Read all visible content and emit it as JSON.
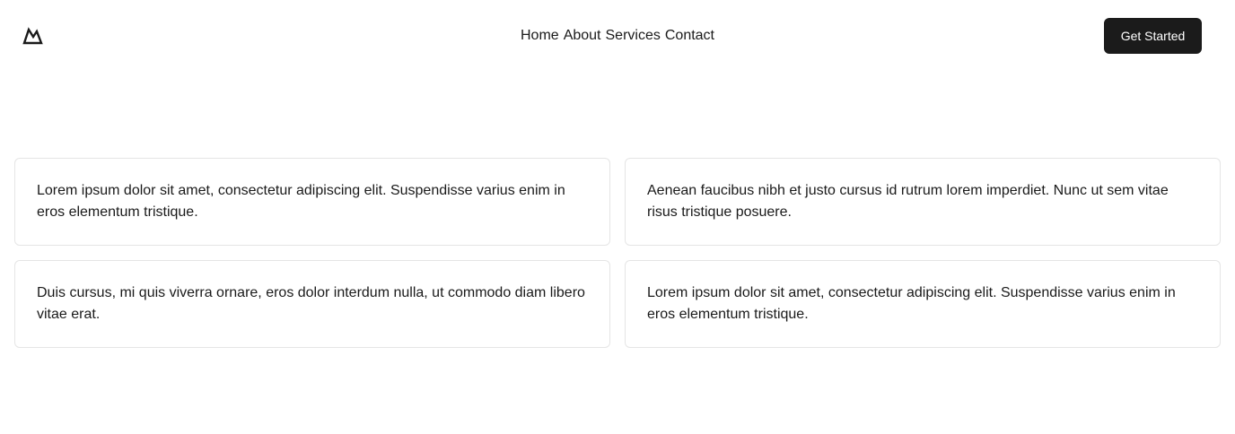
{
  "header": {
    "logo_icon": "mountain-icon",
    "nav": [
      {
        "label": "Home"
      },
      {
        "label": "About"
      },
      {
        "label": "Services"
      },
      {
        "label": "Contact"
      }
    ],
    "cta_label": "Get Started"
  },
  "cards": [
    {
      "text": "Lorem ipsum dolor sit amet, consectetur adipiscing elit. Suspendisse varius enim in eros elementum tristique."
    },
    {
      "text": "Aenean faucibus nibh et justo cursus id rutrum lorem imperdiet. Nunc ut sem vitae risus tristique posuere."
    },
    {
      "text": "Duis cursus, mi quis viverra ornare, eros dolor interdum nulla, ut commodo diam libero vitae erat."
    },
    {
      "text": "Lorem ipsum dolor sit amet, consectetur adipiscing elit. Suspendisse varius enim in eros elementum tristique."
    }
  ],
  "colors": {
    "background": "#ffffff",
    "text": "#1a1a1a",
    "button": "#1b1b1b",
    "button_text": "#ffffff",
    "card_border": "#e5e5e5"
  }
}
